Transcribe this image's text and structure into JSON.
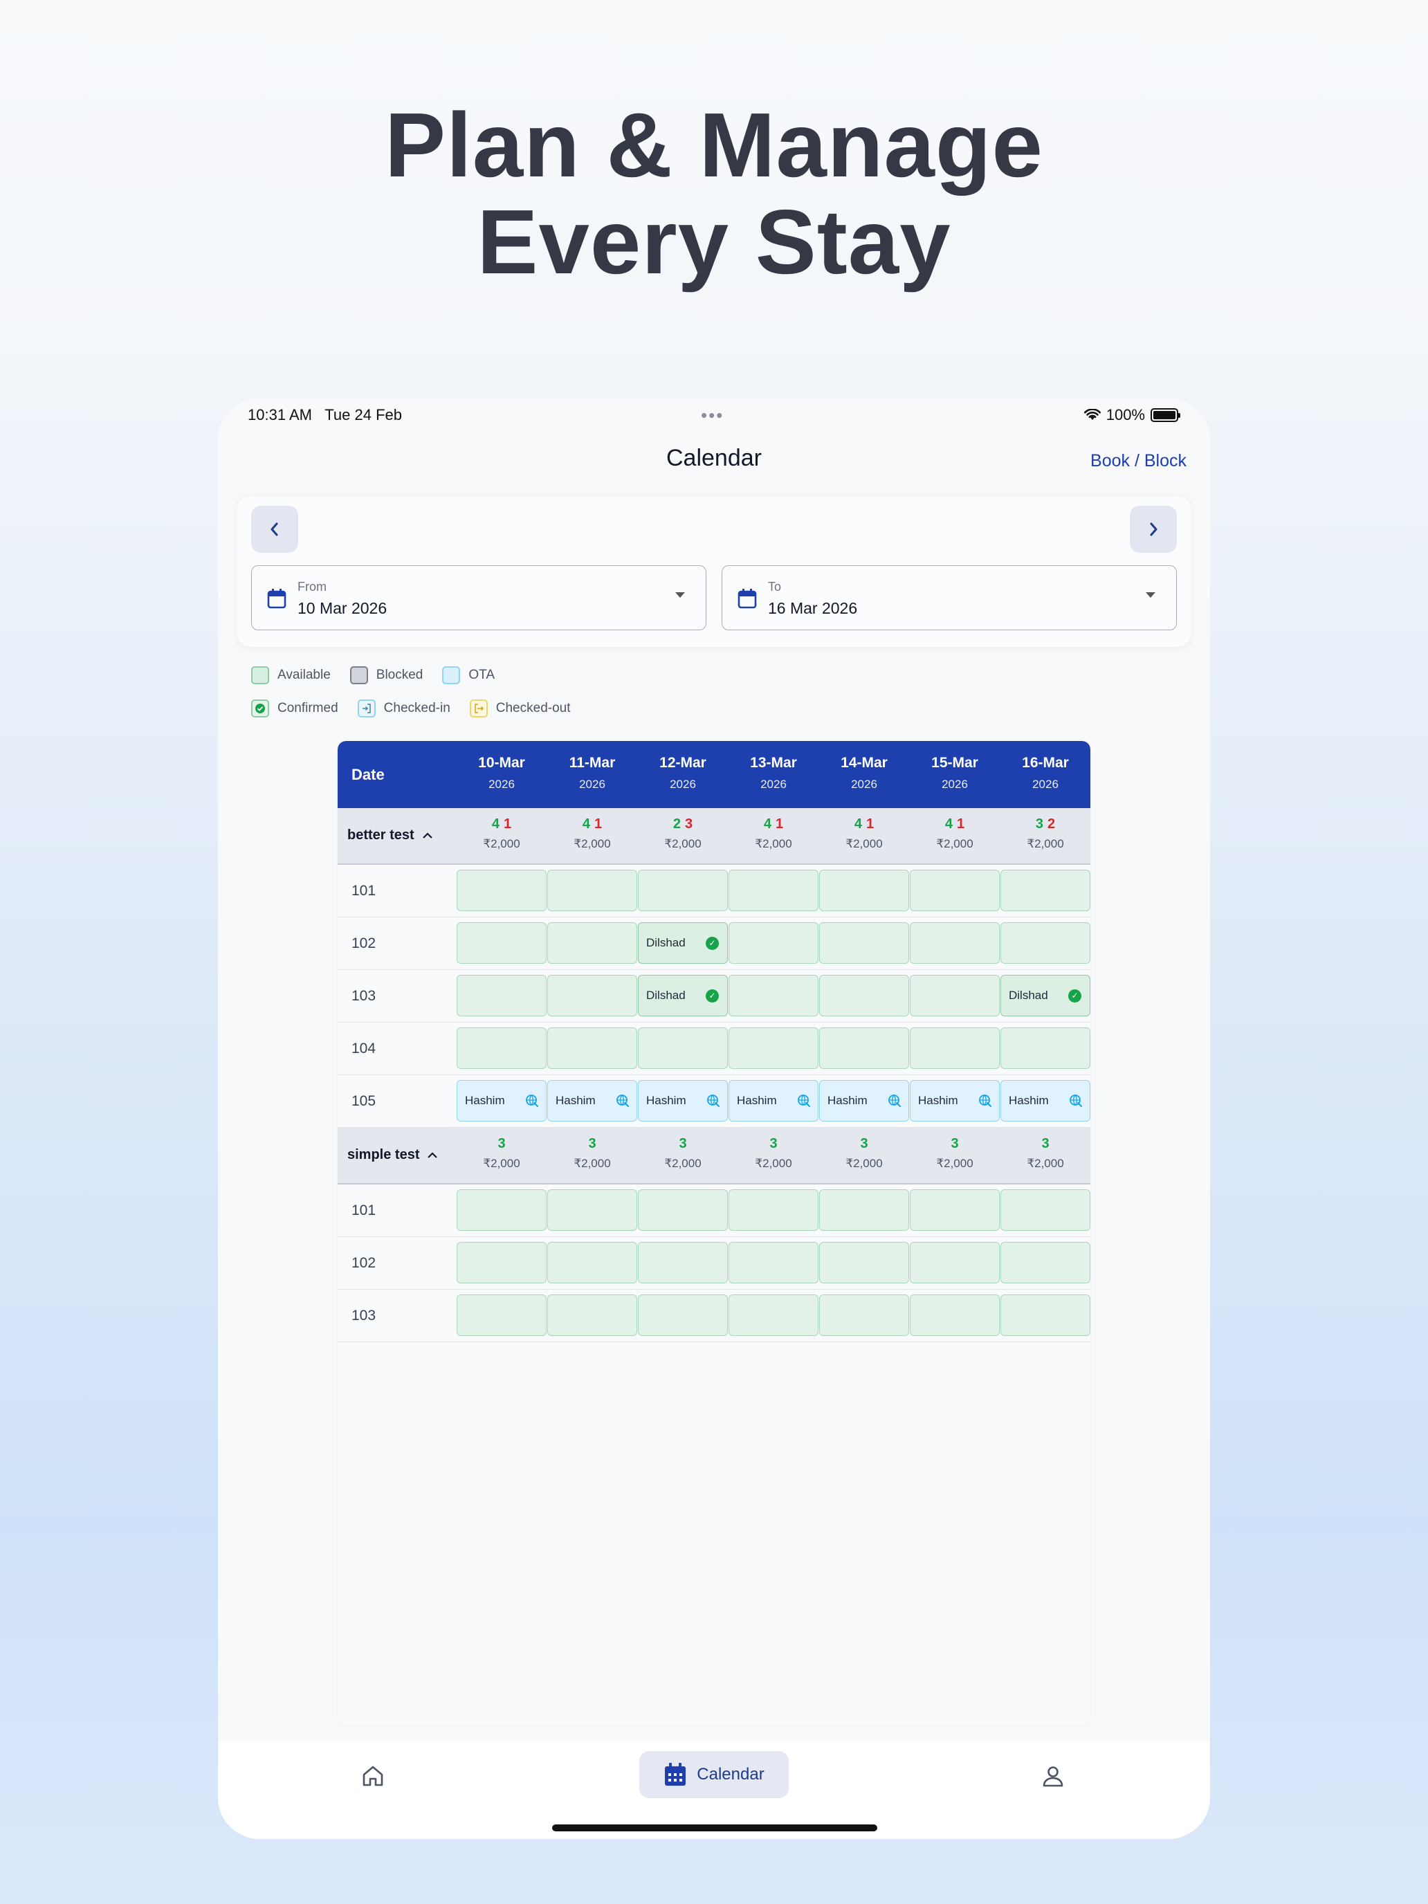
{
  "headline": [
    "Plan & Manage",
    "Every Stay"
  ],
  "status_bar": {
    "time": "10:31 AM",
    "date": "Tue 24 Feb",
    "dots": "•••",
    "battery": "100%"
  },
  "nav": {
    "title": "Calendar",
    "action": "Book / Block"
  },
  "filter": {
    "prev_icon": "chevron-left-icon",
    "next_icon": "chevron-right-icon",
    "from": {
      "label": "From",
      "value": "10 Mar 2026"
    },
    "to": {
      "label": "To",
      "value": "16 Mar 2026"
    }
  },
  "legend": {
    "available": "Available",
    "blocked": "Blocked",
    "ota": "OTA",
    "confirmed": "Confirmed",
    "checked_in": "Checked-in",
    "checked_out": "Checked-out"
  },
  "colors": {
    "header": "#1e40af",
    "available": "#e3f2e9",
    "blocked": "#d1d5db",
    "ota": "#e0f2fd",
    "green": "#16a34a",
    "red": "#dc2626"
  },
  "table": {
    "date_label": "Date",
    "dates": [
      {
        "day": "10-Mar",
        "year": "2026"
      },
      {
        "day": "11-Mar",
        "year": "2026"
      },
      {
        "day": "12-Mar",
        "year": "2026"
      },
      {
        "day": "13-Mar",
        "year": "2026"
      },
      {
        "day": "14-Mar",
        "year": "2026"
      },
      {
        "day": "15-Mar",
        "year": "2026"
      },
      {
        "day": "16-Mar",
        "year": "2026"
      }
    ],
    "groups": [
      {
        "name": "better test",
        "summary": [
          {
            "available": "4",
            "booked": "1",
            "price": "₹2,000"
          },
          {
            "available": "4",
            "booked": "1",
            "price": "₹2,000"
          },
          {
            "available": "2",
            "booked": "3",
            "price": "₹2,000"
          },
          {
            "available": "4",
            "booked": "1",
            "price": "₹2,000"
          },
          {
            "available": "4",
            "booked": "1",
            "price": "₹2,000"
          },
          {
            "available": "4",
            "booked": "1",
            "price": "₹2,000"
          },
          {
            "available": "3",
            "booked": "2",
            "price": "₹2,000"
          }
        ],
        "rooms": [
          {
            "name": "101",
            "cells": [
              {
                "s": "avail"
              },
              {
                "s": "avail"
              },
              {
                "s": "avail"
              },
              {
                "s": "avail"
              },
              {
                "s": "avail"
              },
              {
                "s": "avail"
              },
              {
                "s": "avail"
              }
            ]
          },
          {
            "name": "102",
            "cells": [
              {
                "s": "avail"
              },
              {
                "s": "avail"
              },
              {
                "s": "conf",
                "guest": "Dilshad"
              },
              {
                "s": "avail"
              },
              {
                "s": "avail"
              },
              {
                "s": "avail"
              },
              {
                "s": "avail"
              }
            ]
          },
          {
            "name": "103",
            "cells": [
              {
                "s": "avail"
              },
              {
                "s": "avail"
              },
              {
                "s": "conf",
                "guest": "Dilshad"
              },
              {
                "s": "avail"
              },
              {
                "s": "avail"
              },
              {
                "s": "avail"
              },
              {
                "s": "conf",
                "guest": "Dilshad"
              }
            ]
          },
          {
            "name": "104",
            "cells": [
              {
                "s": "avail"
              },
              {
                "s": "avail"
              },
              {
                "s": "avail"
              },
              {
                "s": "avail"
              },
              {
                "s": "avail"
              },
              {
                "s": "avail"
              },
              {
                "s": "avail"
              }
            ]
          },
          {
            "name": "105",
            "cells": [
              {
                "s": "ota",
                "guest": "Hashim"
              },
              {
                "s": "ota",
                "guest": "Hashim"
              },
              {
                "s": "ota",
                "guest": "Hashim"
              },
              {
                "s": "ota",
                "guest": "Hashim"
              },
              {
                "s": "ota",
                "guest": "Hashim"
              },
              {
                "s": "ota",
                "guest": "Hashim"
              },
              {
                "s": "ota",
                "guest": "Hashim"
              }
            ]
          }
        ]
      },
      {
        "name": "simple test",
        "summary": [
          {
            "available": "3",
            "booked": "",
            "price": "₹2,000"
          },
          {
            "available": "3",
            "booked": "",
            "price": "₹2,000"
          },
          {
            "available": "3",
            "booked": "",
            "price": "₹2,000"
          },
          {
            "available": "3",
            "booked": "",
            "price": "₹2,000"
          },
          {
            "available": "3",
            "booked": "",
            "price": "₹2,000"
          },
          {
            "available": "3",
            "booked": "",
            "price": "₹2,000"
          },
          {
            "available": "3",
            "booked": "",
            "price": "₹2,000"
          }
        ],
        "rooms": [
          {
            "name": "101",
            "cells": [
              {
                "s": "avail"
              },
              {
                "s": "avail"
              },
              {
                "s": "avail"
              },
              {
                "s": "avail"
              },
              {
                "s": "avail"
              },
              {
                "s": "avail"
              },
              {
                "s": "avail"
              }
            ]
          },
          {
            "name": "102",
            "cells": [
              {
                "s": "avail"
              },
              {
                "s": "avail"
              },
              {
                "s": "avail"
              },
              {
                "s": "avail"
              },
              {
                "s": "avail"
              },
              {
                "s": "avail"
              },
              {
                "s": "avail"
              }
            ]
          },
          {
            "name": "103",
            "cells": [
              {
                "s": "avail"
              },
              {
                "s": "avail"
              },
              {
                "s": "avail"
              },
              {
                "s": "avail"
              },
              {
                "s": "avail"
              },
              {
                "s": "avail"
              },
              {
                "s": "avail"
              }
            ]
          }
        ]
      }
    ]
  },
  "tabbar": {
    "home_icon": "home-icon",
    "calendar_label": "Calendar",
    "calendar_icon": "calendar-icon",
    "profile_icon": "profile-icon"
  }
}
